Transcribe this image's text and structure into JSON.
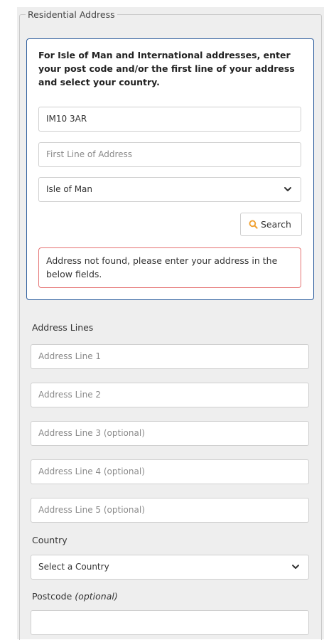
{
  "fieldset": {
    "legend": "Residential Address"
  },
  "lookup": {
    "instructions": "For Isle of Man and International addresses, enter your post code and/or the first line of your address and select your country.",
    "postcode_value": "IM10 3AR",
    "first_line_placeholder": "First Line of Address",
    "country_selected": "Isle of Man",
    "search_label": "Search",
    "error_message": "Address not found, please enter your address in the below fields."
  },
  "address": {
    "section_label": "Address Lines",
    "lines": [
      "Address Line 1",
      "Address Line 2",
      "Address Line 3 (optional)",
      "Address Line 4 (optional)",
      "Address Line 5 (optional)"
    ],
    "country_label": "Country",
    "country_placeholder": "Select a Country",
    "postcode_label": "Postcode",
    "postcode_optional": "(optional)",
    "postcode_value": ""
  },
  "colors": {
    "accent_border": "#2f5f9e",
    "error_border": "#e57373",
    "search_icon": "#f0a030"
  },
  "icons": {
    "search": "search-icon",
    "dropdown": "chevron-down-icon"
  }
}
